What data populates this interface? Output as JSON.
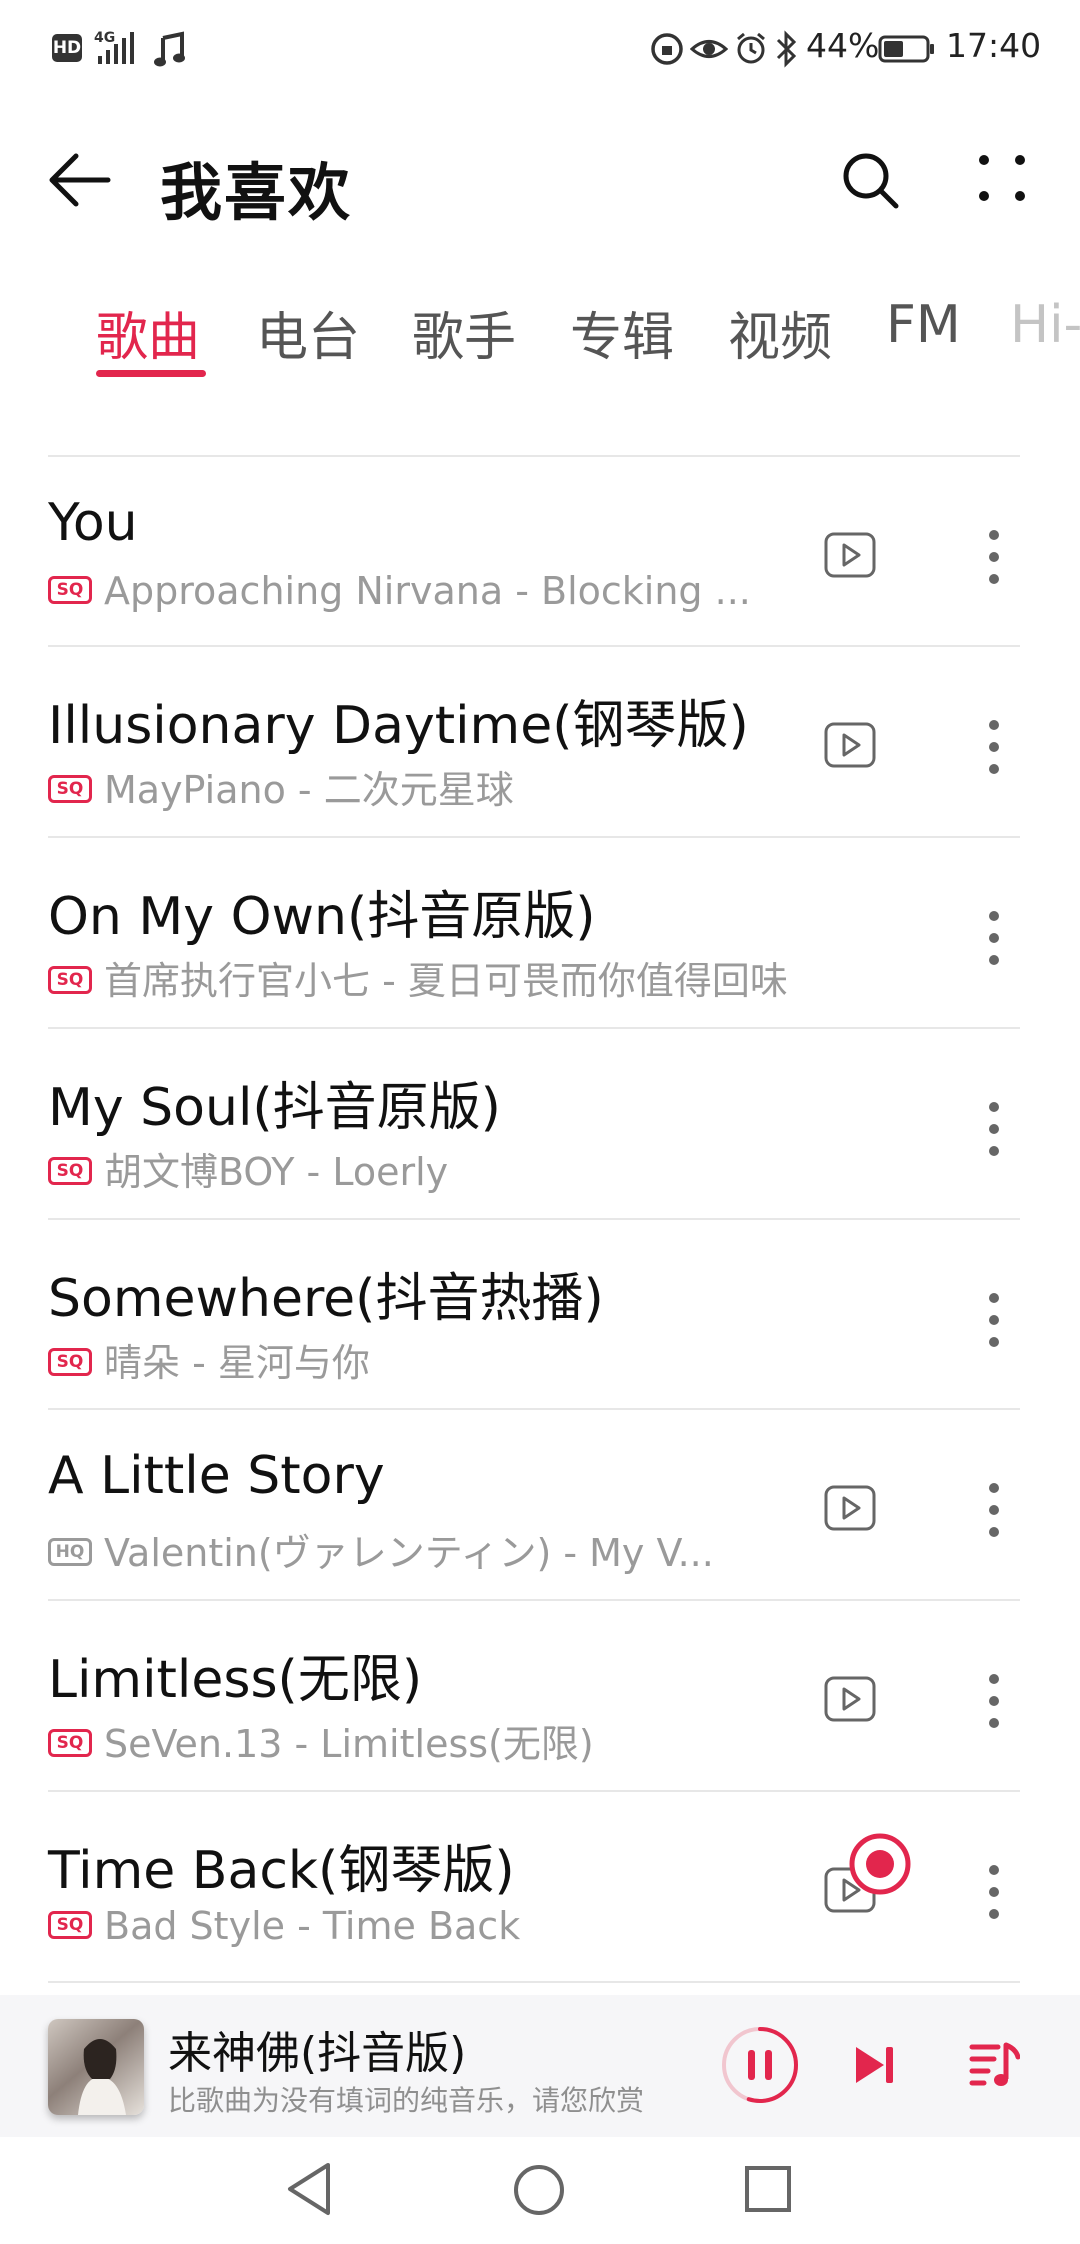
{
  "status_bar": {
    "hd": "HD",
    "network": "4G",
    "battery_percent": "44%",
    "time": "17:40"
  },
  "header": {
    "title": "我喜欢",
    "back_icon": "back-arrow-icon",
    "search_icon": "search-icon",
    "more_icon": "more-dots-icon"
  },
  "tabs": [
    {
      "label": "歌曲",
      "active": true
    },
    {
      "label": "电台",
      "active": false
    },
    {
      "label": "歌手",
      "active": false
    },
    {
      "label": "专辑",
      "active": false
    },
    {
      "label": "视频",
      "active": false
    },
    {
      "label": "FM",
      "active": false
    },
    {
      "label": "Hi-",
      "active": false
    }
  ],
  "songs": [
    {
      "title": "You",
      "quality": "SQ",
      "subtitle": "Approaching Nirvana - Blocking ...",
      "has_mv": true
    },
    {
      "title": "Illusionary Daytime(钢琴版)",
      "quality": "SQ",
      "subtitle": "MayPiano - 二次元星球",
      "has_mv": true
    },
    {
      "title": "On My Own(抖音原版)",
      "quality": "SQ",
      "subtitle": "首席执行官小七 - 夏日可畏而你值得回味",
      "has_mv": false
    },
    {
      "title": "My Soul(抖音原版)",
      "quality": "SQ",
      "subtitle": "胡文博BOY - Loerly",
      "has_mv": false
    },
    {
      "title": "Somewhere(抖音热播)",
      "quality": "SQ",
      "subtitle": "晴朵 - 星河与你",
      "has_mv": false
    },
    {
      "title": "A Little Story",
      "quality": "HQ",
      "subtitle": "Valentin(ヴァレンティン) - My V...",
      "has_mv": true
    },
    {
      "title": "Limitless(无限)",
      "quality": "SQ",
      "subtitle": "SeVen.13 - Limitless(无限)",
      "has_mv": true
    },
    {
      "title": "Time Back(钢琴版)",
      "quality": "SQ",
      "subtitle": "Bad Style - Time Back",
      "has_mv": true
    }
  ],
  "now_playing": {
    "title": "来神佛(抖音版)",
    "subtitle": "比歌曲为没有填词的纯音乐，请您欣赏",
    "progress": 0.55
  },
  "colors": {
    "accent": "#e2264d",
    "text_primary": "#111111",
    "text_secondary": "#9a9a9a"
  }
}
